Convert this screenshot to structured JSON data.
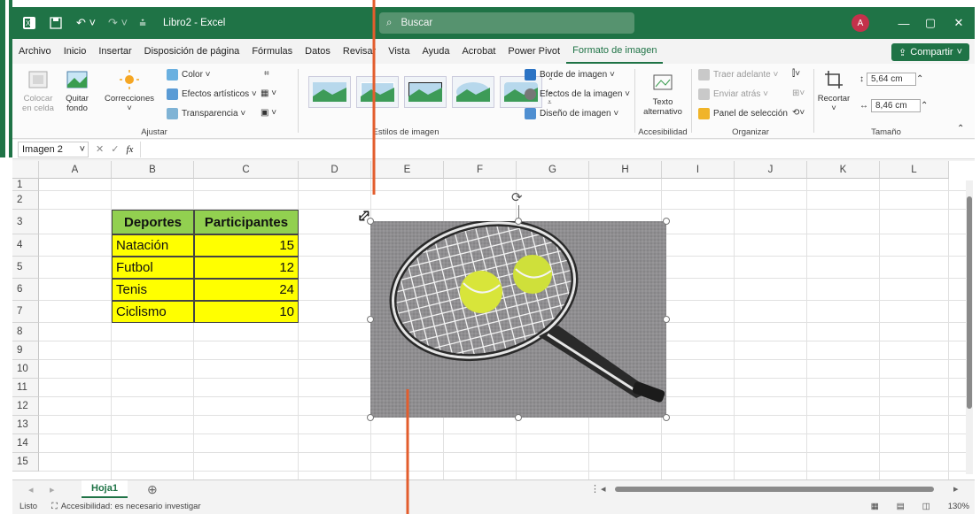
{
  "window": {
    "title": "Libro2  -  Excel",
    "avatar_initial": "A"
  },
  "search": {
    "placeholder": "Buscar"
  },
  "menu": {
    "items": [
      "Archivo",
      "Inicio",
      "Insertar",
      "Disposición de página",
      "Fórmulas",
      "Datos",
      "Revisar",
      "Vista",
      "Ayuda",
      "Acrobat",
      "Power Pivot",
      "Formato de imagen"
    ],
    "active": "Formato de imagen",
    "share": "Compartir"
  },
  "ribbon": {
    "colocar": "Colocar\nen celda",
    "quitar": "Quitar\nfondo",
    "correcciones": "Correcciones",
    "color": "Color",
    "efectos_art": "Efectos artísticos",
    "transparencia": "Transparencia",
    "group_ajustar": "Ajustar",
    "group_estilos": "Estilos de imagen",
    "borde": "Borde de imagen",
    "efectos_img": "Efectos de la imagen",
    "diseno": "Diseño de imagen",
    "texto_alt": "Texto\nalternativo",
    "group_accesibilidad": "Accesibilidad",
    "traer": "Traer adelante",
    "enviar": "Enviar atrás",
    "panel": "Panel de selección",
    "group_organizar": "Organizar",
    "recortar": "Recortar",
    "alto": "5,64 cm",
    "ancho": "8,46 cm",
    "group_tamano": "Tamaño"
  },
  "formula": {
    "namebox": "Imagen 2",
    "fx": "fx"
  },
  "columns": [
    "A",
    "B",
    "C",
    "D",
    "E",
    "F",
    "G",
    "H",
    "I",
    "J",
    "K",
    "L"
  ],
  "rows": [
    "1",
    "2",
    "3",
    "4",
    "5",
    "6",
    "7",
    "8",
    "9",
    "10",
    "11",
    "12",
    "13",
    "14",
    "15"
  ],
  "table": {
    "headers": [
      "Deportes",
      "Participantes"
    ],
    "rows": [
      [
        "Natación",
        "15"
      ],
      [
        "Futbol",
        "12"
      ],
      [
        "Tenis",
        "24"
      ],
      [
        "Ciclismo",
        "10"
      ]
    ]
  },
  "sheet": {
    "tab": "Hoja1"
  },
  "status": {
    "ready": "Listo",
    "accessibility": "Accesibilidad: es necesario investigar",
    "zoom": "130%"
  },
  "colors": {
    "excel_green": "#1f7346",
    "header_fill": "#92d050",
    "cell_fill": "#ffff00",
    "callout": "#e35d2d"
  }
}
